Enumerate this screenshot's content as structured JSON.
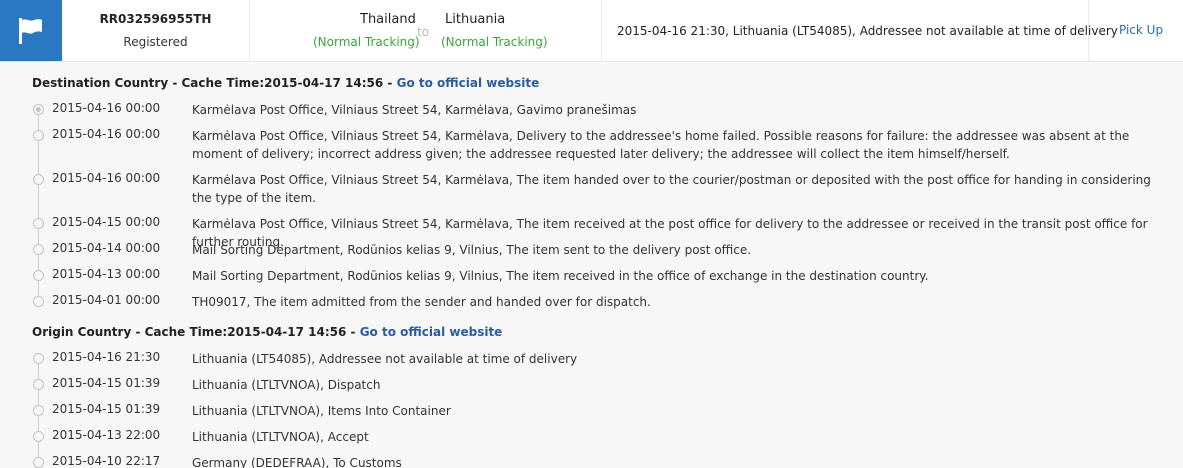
{
  "header": {
    "tracking_number": "RR032596955TH",
    "tracking_status": "Registered",
    "origin_country": "Thailand",
    "origin_mode": "(Normal Tracking)",
    "to_label": "to",
    "dest_country": "Lithuania",
    "dest_mode": "(Normal Tracking)",
    "latest_event": "2015-04-16 21:30, Lithuania (LT54085), Addressee not available at time of delivery",
    "action_label": "Pick Up",
    "flag_icon": "flag-icon"
  },
  "destination": {
    "label": "Destination Country - Cache Time:2015-04-17 14:56 - ",
    "link": "Go to official website",
    "events": [
      {
        "time": "2015-04-16 00:00",
        "desc": "Karmėlava Post Office, Vilniaus Street 54, Karmėlava, Gavimo pranešimas"
      },
      {
        "time": "2015-04-16 00:00",
        "desc": "Karmėlava Post Office, Vilniaus Street 54, Karmėlava, Delivery to the addressee's home failed. Possible reasons for failure: the addressee was absent at the moment of delivery; incorrect address given; the addressee requested later delivery; the addressee will collect the item himself/herself."
      },
      {
        "time": "2015-04-16 00:00",
        "desc": "Karmėlava Post Office, Vilniaus Street 54, Karmėlava, The item handed over to the courier/postman or deposited with the post office for handing in considering the type of the item."
      },
      {
        "time": "2015-04-15 00:00",
        "desc": "Karmėlava Post Office, Vilniaus Street 54, Karmėlava, The item received at the post office for delivery to the addressee or received in the transit post office for further routing."
      },
      {
        "time": "2015-04-14 00:00",
        "desc": "Mail Sorting Department, Rodūnios kelias 9, Vilnius, The item sent to the delivery post office."
      },
      {
        "time": "2015-04-13 00:00",
        "desc": "Mail Sorting Department, Rodūnios kelias 9, Vilnius, The item received in the office of exchange in the destination country."
      },
      {
        "time": "2015-04-01 00:00",
        "desc": "TH09017, The item admitted from the sender and handed over for dispatch."
      }
    ]
  },
  "origin": {
    "label": "Origin Country - Cache Time:2015-04-17 14:56 - ",
    "link": "Go to official website",
    "events": [
      {
        "time": "2015-04-16 21:30",
        "desc": "Lithuania (LT54085), Addressee not available at time of delivery"
      },
      {
        "time": "2015-04-15 01:39",
        "desc": "Lithuania (LTLTVNOA), Dispatch"
      },
      {
        "time": "2015-04-15 01:39",
        "desc": "Lithuania (LTLTVNOA), Items Into Container"
      },
      {
        "time": "2015-04-13 22:00",
        "desc": "Lithuania (LTLTVNOA), Accept"
      },
      {
        "time": "2015-04-10 22:17",
        "desc": "Germany (DEDEFRAA), To Customs"
      }
    ]
  }
}
